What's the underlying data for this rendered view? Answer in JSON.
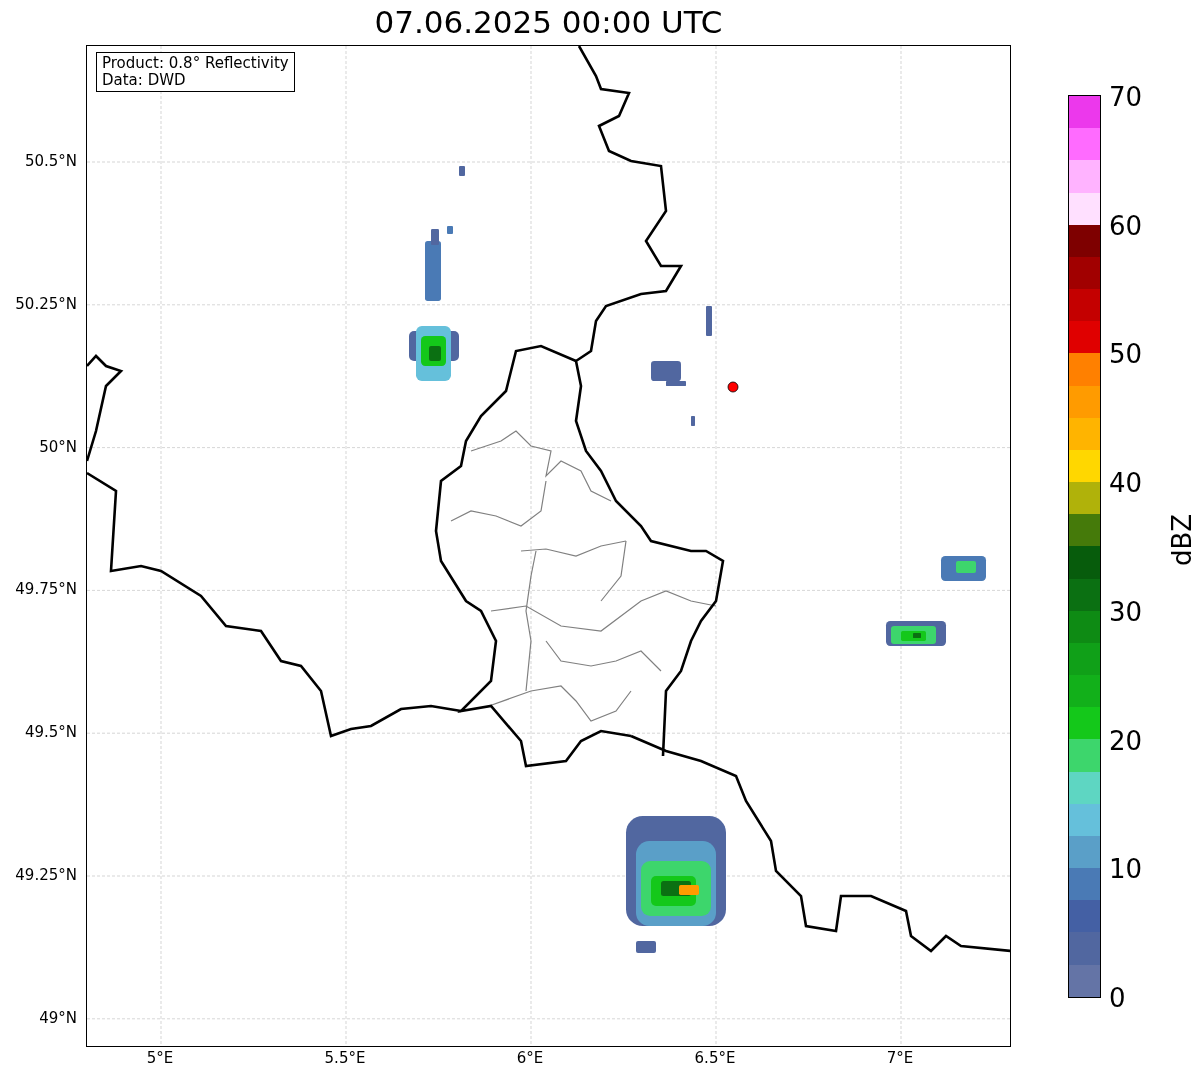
{
  "title": "07.06.2025 00:00 UTC",
  "info_box": {
    "lines": [
      "Product: 0.8° Reflectivity",
      "Data: DWD"
    ]
  },
  "map": {
    "yticks": [
      "50.5°N",
      "50.25°N",
      "50°N",
      "49.75°N",
      "49.5°N",
      "49.25°N",
      "49°N"
    ],
    "xticks": [
      "5°E",
      "5.5°E",
      "6°E",
      "6.5°E",
      "7°E"
    ]
  },
  "colorbar": {
    "label": "dBZ",
    "ticks": [
      "70",
      "60",
      "50",
      "40",
      "30",
      "20",
      "10",
      "0"
    ],
    "segments": [
      {
        "color": "#ec38ec"
      },
      {
        "color": "#ff6bff"
      },
      {
        "color": "#ffb3ff"
      },
      {
        "color": "#ffe0ff"
      },
      {
        "color": "#7e0000"
      },
      {
        "color": "#a10000"
      },
      {
        "color": "#c40000"
      },
      {
        "color": "#e00000"
      },
      {
        "color": "#ff8000"
      },
      {
        "color": "#ff9b00"
      },
      {
        "color": "#ffb400"
      },
      {
        "color": "#ffd700"
      },
      {
        "color": "#b0b20a"
      },
      {
        "color": "#457a0a"
      },
      {
        "color": "#075c0c"
      },
      {
        "color": "#0b7012"
      },
      {
        "color": "#0e8b14"
      },
      {
        "color": "#10a018"
      },
      {
        "color": "#12b01a"
      },
      {
        "color": "#14c81a"
      },
      {
        "color": "#3dd66c"
      },
      {
        "color": "#5ed6c2"
      },
      {
        "color": "#65c0db"
      },
      {
        "color": "#5a9fc8"
      },
      {
        "color": "#4a7ab5"
      },
      {
        "color": "#4460a4"
      },
      {
        "color": "#5167a0"
      },
      {
        "color": "#6474a6"
      }
    ]
  }
}
